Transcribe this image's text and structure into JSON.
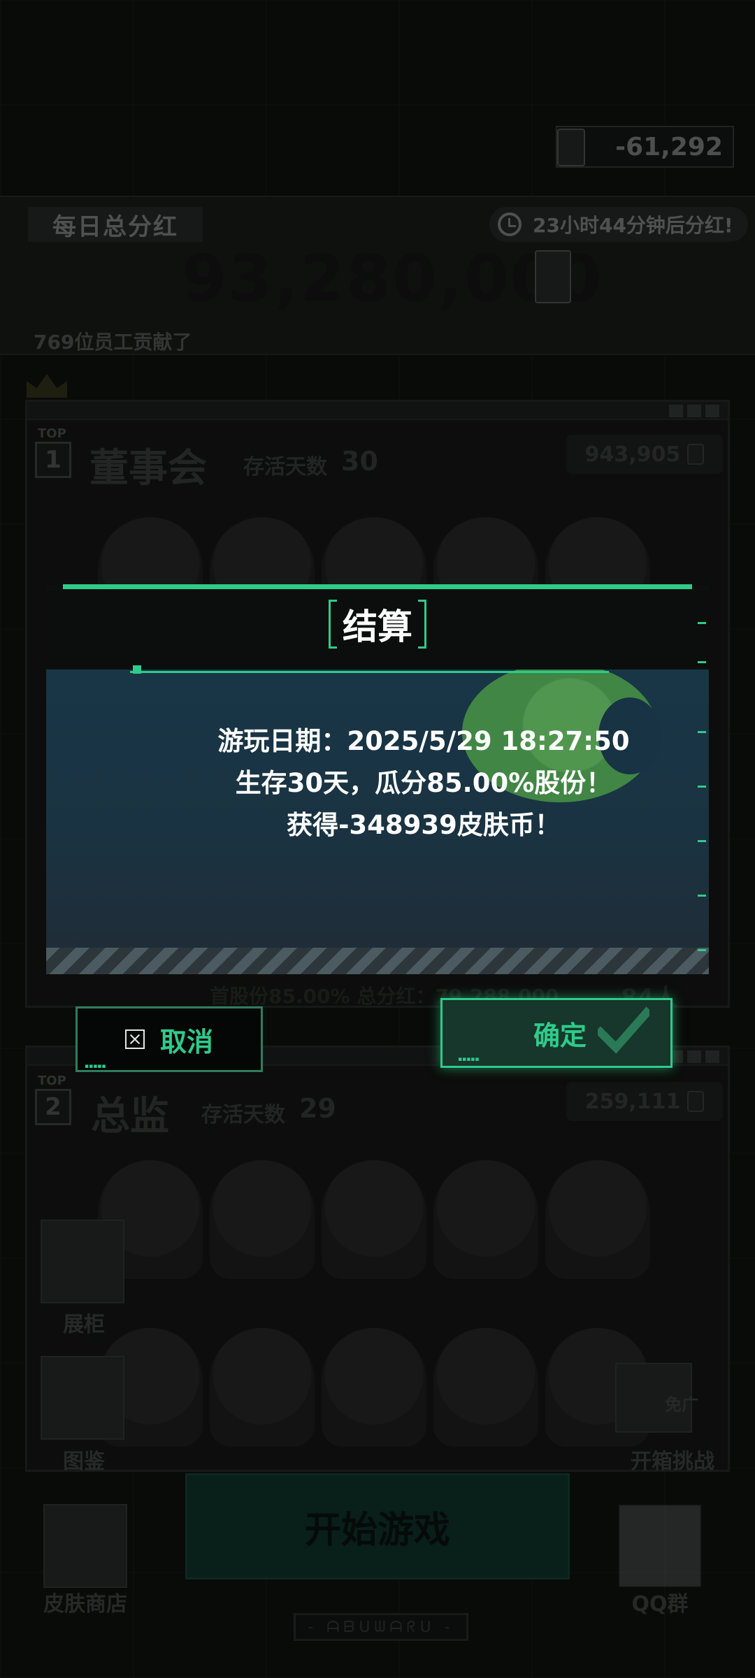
{
  "header": {
    "balance": "-61,292"
  },
  "dividend": {
    "label": "每日总分红",
    "timer": "23小时44分钟后分红!",
    "amount": "93,280,000",
    "contributors": "769位员工贡献了"
  },
  "panels": [
    {
      "top_tag": "TOP",
      "rank": "1",
      "title": "董事会",
      "days_label": "存活天数",
      "days": "30",
      "score": "943,905",
      "share_line": "首股份85.00%   总分红：79,288,000",
      "count": "84人"
    },
    {
      "top_tag": "TOP",
      "rank": "2",
      "title": "总监",
      "days_label": "存活天数",
      "days": "29",
      "score": "259,111"
    }
  ],
  "side_menu": {
    "showcase": "展柜",
    "catalog": "图鉴",
    "skin_shop": "皮肤商店",
    "chest_challenge": "开箱挑战",
    "free_tag": "免广",
    "qq_group": "QQ群"
  },
  "start_button": "开始游戏",
  "bottom_strip": "- ᗩᗷᑌᗯᗩᖇᑌ -",
  "dialog": {
    "title": "结算",
    "line1": "游玩日期：2025/5/29 18:27:50",
    "line2": "生存30天，瓜分85.00%股份！",
    "line3": "获得-348939皮肤币！",
    "cancel": "取消",
    "confirm": "确定"
  },
  "colors": {
    "accent": "#2ecb8b",
    "dialog_bg": "#183646",
    "planet": "#5fae52"
  },
  "icons": [
    "card-icon",
    "clock-icon",
    "crown-icon",
    "cancel-icon",
    "check-icon",
    "qq-icon"
  ]
}
